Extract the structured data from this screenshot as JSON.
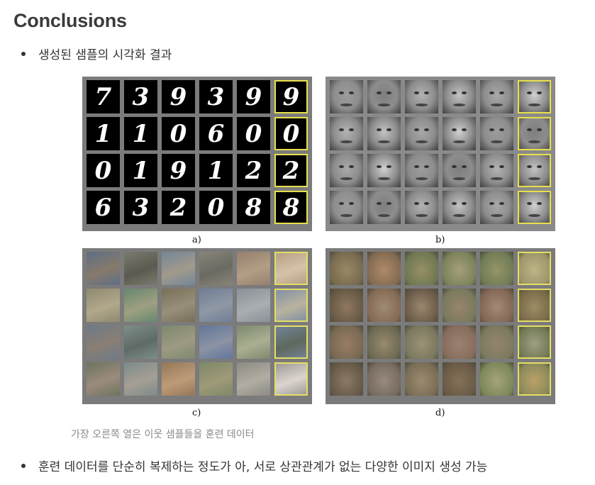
{
  "heading": "Conclusions",
  "bullets": [
    "생성된 샘플의 시각화 결과",
    "훈련 데이터를 단순히 복제하는 정도가 아, 서로 상관관계가 없는 다양한 이미지 생성 가능"
  ],
  "figure": {
    "captions": [
      "a)",
      "b)",
      "c)",
      "d)"
    ],
    "note": "가장 오른쪽 열은 이웃 샘플들을 훈련 데이터",
    "highlight_color": "#e7e04a",
    "mnist_digits": [
      [
        "7",
        "3",
        "9",
        "3",
        "9",
        "9"
      ],
      [
        "1",
        "1",
        "0",
        "6",
        "0",
        "0"
      ],
      [
        "0",
        "1",
        "9",
        "1",
        "2",
        "2"
      ],
      [
        "6",
        "3",
        "2",
        "0",
        "8",
        "8"
      ]
    ]
  }
}
